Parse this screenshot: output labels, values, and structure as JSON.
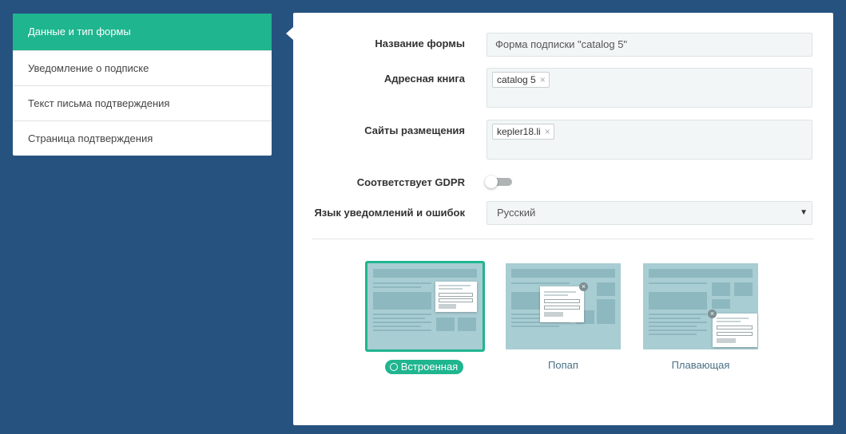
{
  "sidebar": {
    "items": [
      {
        "label": "Данные и тип формы",
        "active": true
      },
      {
        "label": "Уведомление о подписке"
      },
      {
        "label": "Текст письма подтверждения"
      },
      {
        "label": "Страница подтверждения"
      }
    ]
  },
  "form": {
    "name_label": "Название формы",
    "name_value": "Форма подписки \"catalog 5\"",
    "addressbook_label": "Адресная книга",
    "addressbook_tag": "catalog 5",
    "sites_label": "Сайты размещения",
    "sites_tag": "kepler18.li",
    "gdpr_label": "Соответствует GDPR",
    "gdpr_enabled": false,
    "language_label": "Язык уведомлений и ошибок",
    "language_value": "Русский"
  },
  "form_types": [
    {
      "label": "Встроенная",
      "selected": true
    },
    {
      "label": "Попап",
      "selected": false
    },
    {
      "label": "Плавающая",
      "selected": false
    }
  ],
  "icons": {
    "tag_remove": "×",
    "select_caret": "▼",
    "popup_close": "×"
  },
  "colors": {
    "background": "#265280",
    "accent": "#1fb58f",
    "preview": "#a8cdd3"
  }
}
